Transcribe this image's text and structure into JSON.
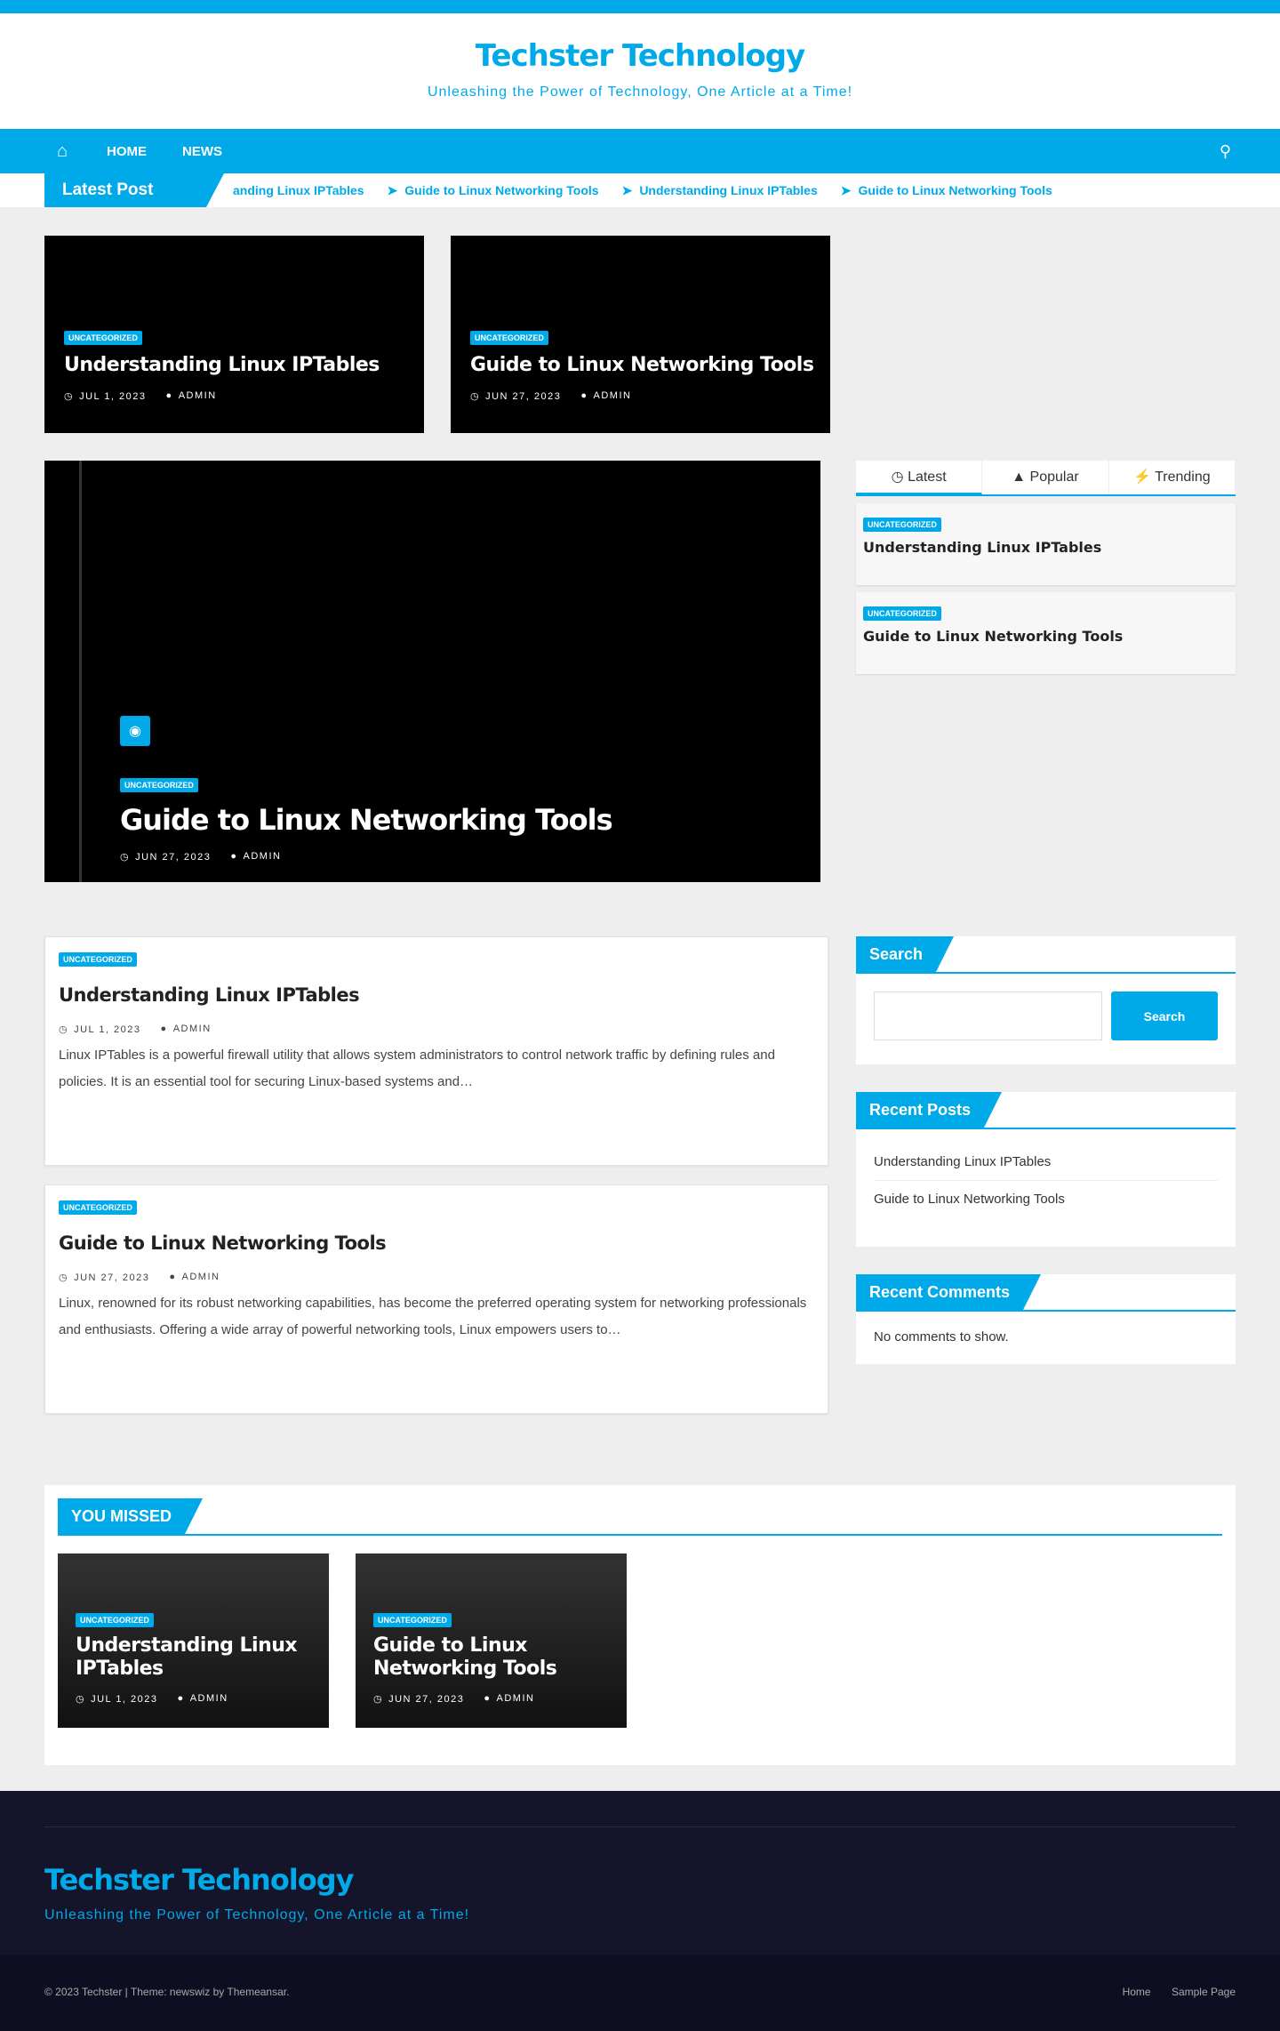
{
  "site": {
    "title": "Techster Technology",
    "tagline": "Unleashing the Power of Technology, One Article at a Time!"
  },
  "nav": {
    "home_icon": "home-icon",
    "items": [
      "HOME",
      "NEWS"
    ],
    "search_icon": "search-icon"
  },
  "ticker": {
    "label": "Latest Post",
    "items": [
      "anding Linux IPTables",
      "Guide to Linux Networking Tools",
      "Understanding Linux IPTables",
      "Guide to Linux Networking Tools"
    ]
  },
  "featured": [
    {
      "category": "UNCATEGORIZED",
      "title": "Understanding Linux IPTables",
      "date": "JUL 1, 2023",
      "author": "ADMIN"
    },
    {
      "category": "UNCATEGORIZED",
      "title": "Guide to Linux Networking Tools",
      "date": "JUN 27, 2023",
      "author": "ADMIN"
    }
  ],
  "hero": {
    "category": "UNCATEGORIZED",
    "title": "Guide to Linux Networking Tools",
    "date": "JUN 27, 2023",
    "author": "ADMIN"
  },
  "tabs": {
    "labels": [
      "Latest",
      "Popular",
      "Trending"
    ],
    "posts": [
      {
        "category": "UNCATEGORIZED",
        "title": "Understanding Linux IPTables"
      },
      {
        "category": "UNCATEGORIZED",
        "title": "Guide to Linux Networking Tools"
      }
    ]
  },
  "posts": [
    {
      "category": "UNCATEGORIZED",
      "title": "Understanding Linux IPTables",
      "date": "JUL 1, 2023",
      "author": "ADMIN",
      "excerpt": "Linux IPTables is a powerful firewall utility that allows system administrators to control network traffic by defining rules and policies. It is an essential tool for securing Linux-based systems and…"
    },
    {
      "category": "UNCATEGORIZED",
      "title": "Guide to Linux Networking Tools",
      "date": "JUN 27, 2023",
      "author": "ADMIN",
      "excerpt": "Linux, renowned for its robust networking capabilities, has become the preferred operating system for networking professionals and enthusiasts. Offering a wide array of powerful networking tools, Linux empowers users to…"
    }
  ],
  "widgets": {
    "search_title": "Search",
    "search_button": "Search",
    "recent_posts_title": "Recent Posts",
    "recent_posts": [
      "Understanding Linux IPTables",
      "Guide to Linux Networking Tools"
    ],
    "recent_comments_title": "Recent Comments",
    "no_comments": "No comments to show."
  },
  "missed": {
    "title": "YOU MISSED",
    "items": [
      {
        "category": "UNCATEGORIZED",
        "title": "Understanding Linux IPTables",
        "date": "JUL 1, 2023",
        "author": "ADMIN"
      },
      {
        "category": "UNCATEGORIZED",
        "title": "Guide to Linux Networking Tools",
        "date": "JUN 27, 2023",
        "author": "ADMIN"
      }
    ]
  },
  "footer": {
    "title": "Techster Technology",
    "tagline": "Unleashing the Power of Technology, One Article at a Time!",
    "copyright": "© 2023 Techster | Theme: newswiz by Themeansar.",
    "links": [
      "Home",
      "Sample Page"
    ]
  },
  "colors": {
    "accent": "#00a9e8",
    "footer_bg": "#14142b"
  }
}
